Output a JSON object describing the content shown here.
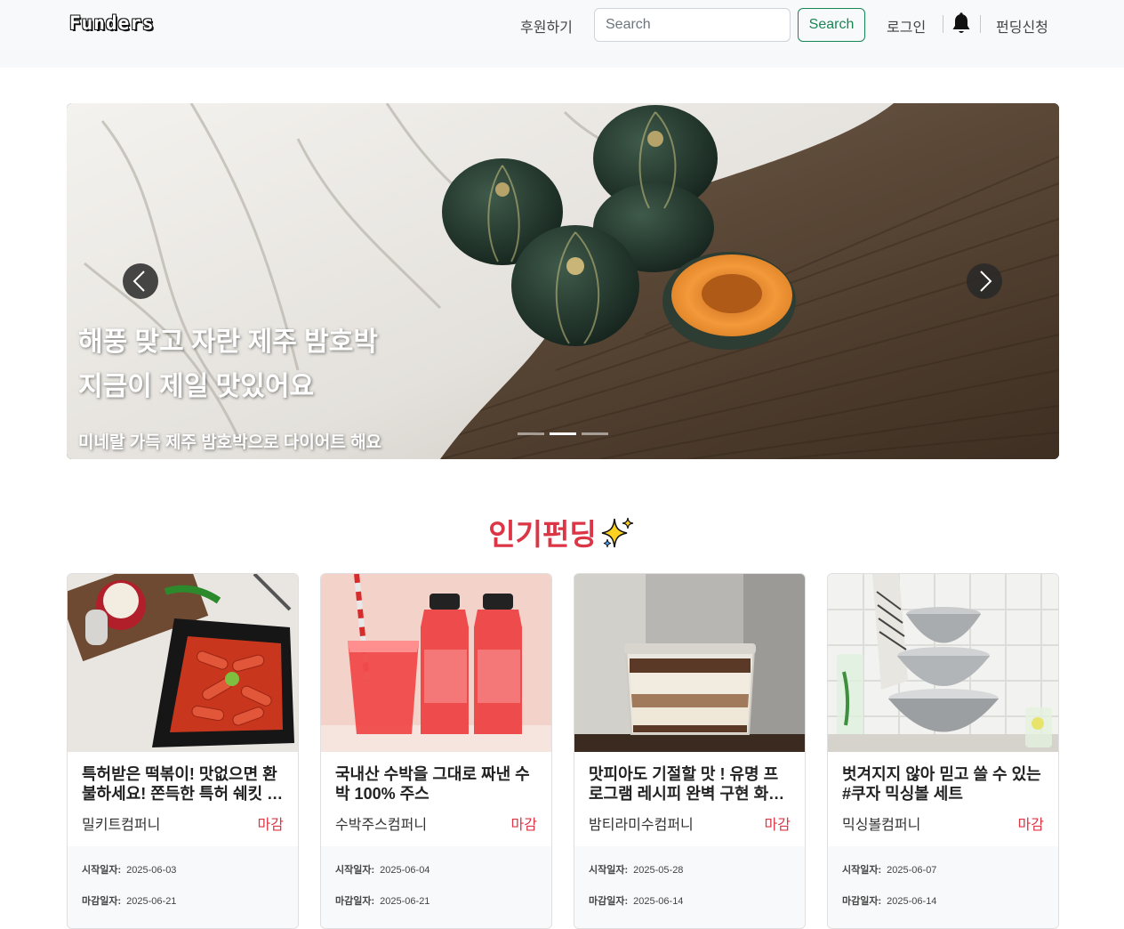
{
  "navbar": {
    "logo": "Funders",
    "support_link": "후원하기",
    "search_placeholder": "Search",
    "search_button": "Search",
    "login_link": "로그인",
    "funding_apply_link": "펀딩신청"
  },
  "carousel": {
    "title_line1": "해풍 맞고 자란 제주 밤호박",
    "title_line2": "지금이 제일 맛있어요",
    "subtitle": "미네랄 가득 제주 밤호박으로 다이어트 해요",
    "slide_count": 3,
    "active_slide": 2
  },
  "popular": {
    "title": "인기펀딩",
    "start_label": "시작일자:",
    "end_label": "마감일자:",
    "cards": [
      {
        "title": "특허받은 떡볶이! 맛없으면 환불하세요! 쫀득한 특허 쉐킷 떡볶이",
        "company": "밀키트컴퍼니",
        "status": "마감",
        "start_date": "2025-06-03",
        "end_date": "2025-06-21"
      },
      {
        "title": "국내산 수박을 그대로 짜낸 수박 100% 주스",
        "company": "수박주스컴퍼니",
        "status": "마감",
        "start_date": "2025-06-04",
        "end_date": "2025-06-21"
      },
      {
        "title": "맛피아도 기절할 맛 ! 유명 프로그램 레시피 완벽 구현 화제의 티라미수",
        "company": "밤티라미수컴퍼니",
        "status": "마감",
        "start_date": "2025-05-28",
        "end_date": "2025-06-14"
      },
      {
        "title": "벗겨지지 않아 믿고 쓸 수 있는 #쿠자 믹싱볼 세트",
        "company": "믹싱볼컴퍼니",
        "status": "마감",
        "start_date": "2025-06-07",
        "end_date": "2025-06-14"
      }
    ]
  }
}
